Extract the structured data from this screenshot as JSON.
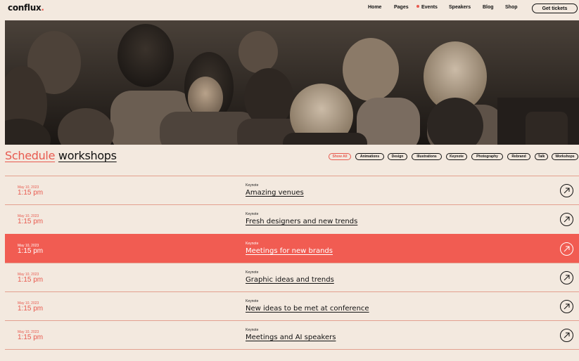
{
  "header": {
    "logo": "conflux",
    "logo_dot": ".",
    "nav": [
      "Home",
      "Pages",
      "Events",
      "Speakers",
      "Blog",
      "Shop"
    ],
    "active_nav": "Events",
    "cta": "Get tickets"
  },
  "hero": {
    "alt": "audience-photo"
  },
  "section": {
    "title_accent": "Schedule",
    "title_main": "workshops"
  },
  "filters": [
    "Show All",
    "Animations",
    "Design",
    "Illustrations",
    "Keynote",
    "Photography",
    "Rebrand",
    "Talk",
    "Workshops"
  ],
  "events": [
    {
      "date": "May 10, 2023",
      "time": "1:15 pm",
      "category": "Keynote",
      "title": "Amazing venues"
    },
    {
      "date": "May 10, 2023",
      "time": "1:15 pm",
      "category": "Keynote",
      "title": "Fresh designers and new trends"
    },
    {
      "date": "May 10, 2023",
      "time": "1:15 pm",
      "category": "Keynote",
      "title": "Meetings for new brands"
    },
    {
      "date": "May 10, 2023",
      "time": "1:15 pm",
      "category": "Keynote",
      "title": "Graphic ideas and trends"
    },
    {
      "date": "May 10, 2023",
      "time": "1:15 pm",
      "category": "Keynote",
      "title": "New ideas to be met at conference"
    },
    {
      "date": "May 10, 2023",
      "time": "1:15 pm",
      "category": "Keynote",
      "title": "Meetings and AI speakers"
    }
  ],
  "colors": {
    "accent": "#e85a4f",
    "background": "#f3e9df",
    "highlight_row": "#f15c52"
  }
}
